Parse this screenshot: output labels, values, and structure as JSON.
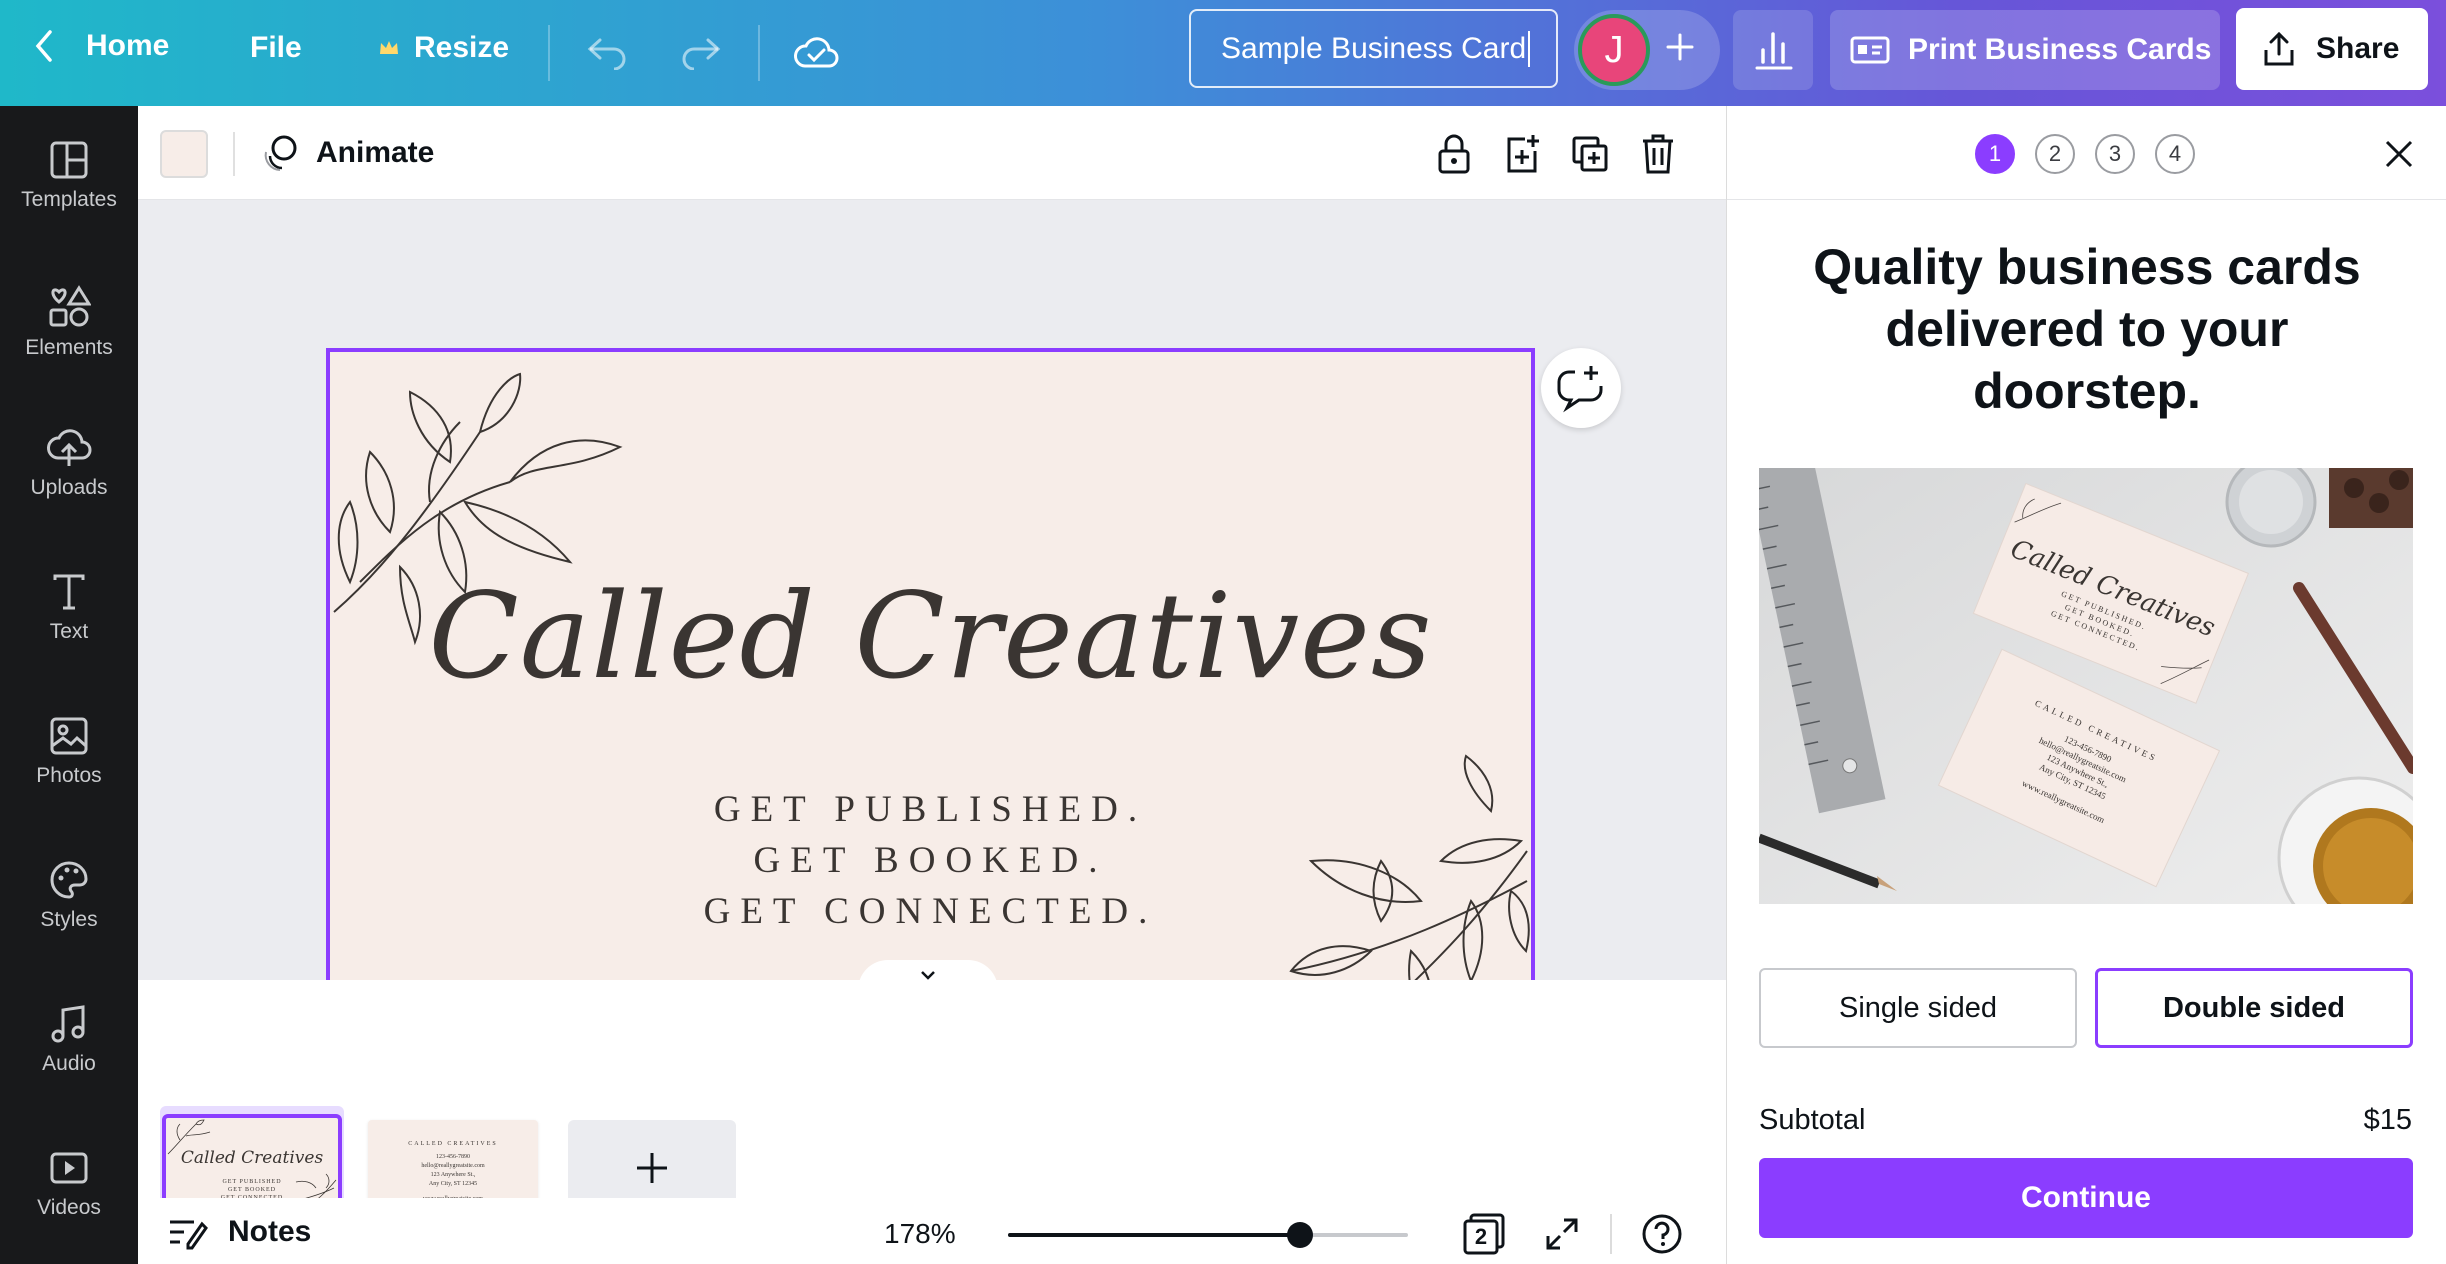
{
  "topbar": {
    "home_label": "Home",
    "file_label": "File",
    "resize_label": "Resize",
    "design_title": "Sample Business Card",
    "avatar_initial": "J",
    "print_label": "Print Business Cards",
    "share_label": "Share",
    "gradient_colors": [
      "#1fb8c9",
      "#3d8fd8",
      "#6656d8",
      "#7b4fdc"
    ]
  },
  "sidebar": {
    "items": [
      {
        "label": "Templates",
        "icon": "templates-icon"
      },
      {
        "label": "Elements",
        "icon": "elements-icon"
      },
      {
        "label": "Uploads",
        "icon": "cloud-upload-icon"
      },
      {
        "label": "Text",
        "icon": "text-icon"
      },
      {
        "label": "Photos",
        "icon": "photos-icon"
      },
      {
        "label": "Styles",
        "icon": "palette-icon"
      },
      {
        "label": "Audio",
        "icon": "music-note-icon"
      },
      {
        "label": "Videos",
        "icon": "video-icon"
      }
    ]
  },
  "toolbar": {
    "animate_label": "Animate",
    "background_color": "#f7ede8"
  },
  "card": {
    "script_title": "Called Creatives",
    "lines": [
      "GET PUBLISHED.",
      "GET BOOKED.",
      "GET CONNECTED."
    ]
  },
  "pages": {
    "page1_number": "1",
    "page2_number": "2",
    "thumb1_title": "Called Creatives",
    "thumb1_lines": [
      "GET PUBLISHED",
      "GET BOOKED",
      "GET CONNECTED"
    ],
    "thumb2_lines": [
      "CALLED CREATIVES",
      "123-456-7890",
      "hello@reallygreatsite.com",
      "123 Anywhere St.,",
      "Any City, ST 12345",
      "www.reallygreatsite.com"
    ]
  },
  "bottombar": {
    "notes_label": "Notes",
    "zoom_label": "178%",
    "zoom_fraction": 0.73,
    "page_count": "2"
  },
  "panel": {
    "steps": [
      "1",
      "2",
      "3",
      "4"
    ],
    "active_step": "1",
    "heading": "Quality business cards delivered to your doorstep.",
    "promo_card_title": "Called Creatives",
    "promo_card_lines": [
      "GET PUBLISHED.",
      "GET BOOKED.",
      "GET CONNECTED."
    ],
    "promo_back_lines": [
      "CALLED CREATIVES",
      "123-456-7890",
      "hello@reallygreatsite.com",
      "123 Anywhere St.,",
      "Any City, ST 12345",
      "www.reallygreatsite.com"
    ],
    "option_single": "Single sided",
    "option_double": "Double sided",
    "selected_option": "Double sided",
    "subtotal_label": "Subtotal",
    "subtotal_value": "$15",
    "continue_label": "Continue",
    "accent_color": "#8b3dff"
  }
}
